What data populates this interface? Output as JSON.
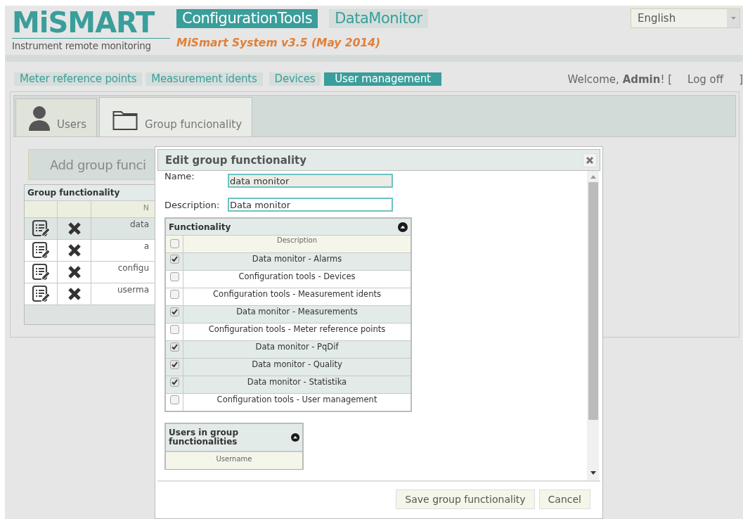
{
  "logo": {
    "brand": "MiSMART",
    "tagline": "Instrument remote monitoring"
  },
  "apps": [
    {
      "label": "ConfigurationTools",
      "selected": true
    },
    {
      "label": "DataMonitor",
      "selected": false
    }
  ],
  "version": "MiSmart System v3.5 (May 2014)",
  "language": {
    "value": "English"
  },
  "menu": [
    {
      "label": "Meter reference points",
      "selected": false
    },
    {
      "label": "Measurement idents",
      "selected": false
    },
    {
      "label": "Devices",
      "selected": false
    },
    {
      "label": "User management",
      "selected": true
    }
  ],
  "user_bar": {
    "welcome": "Welcome, **Admin**! [",
    "logoff": "Log off",
    "bracket": "]"
  },
  "page_tabs": [
    {
      "label": "Users",
      "kind": "user",
      "selected": false
    },
    {
      "label": "Group funcionality",
      "kind": "folder",
      "selected": true
    }
  ],
  "add_button": "Add group funci",
  "group_table": {
    "title": "Group functionality",
    "column_3": "N",
    "rows": [
      {
        "name": "data",
        "selected": true
      },
      {
        "name": "a",
        "selected": false
      },
      {
        "name": "configu",
        "selected": false
      },
      {
        "name": "userma",
        "selected": false
      }
    ]
  },
  "dialog": {
    "title": "Edit group functionality",
    "fields": [
      {
        "label": "Name:",
        "value": "data monitor",
        "disabled": true
      },
      {
        "label": "Description:",
        "value": "Data monitor",
        "disabled": false
      }
    ],
    "functionality": {
      "title": "Functionality",
      "header": "Description",
      "all_checked": false,
      "rows": [
        {
          "label": "Data monitor - Alarms",
          "checked": true
        },
        {
          "label": "Configuration tools - Devices",
          "checked": false
        },
        {
          "label": "Configuration tools - Measurement idents",
          "checked": false
        },
        {
          "label": "Data monitor - Measurements",
          "checked": true
        },
        {
          "label": "Configuration tools - Meter reference points",
          "checked": false
        },
        {
          "label": "Data monitor - PqDif",
          "checked": true
        },
        {
          "label": "Data monitor - Quality",
          "checked": true
        },
        {
          "label": "Data monitor - Statistika",
          "checked": true
        },
        {
          "label": "Configuration tools - User management",
          "checked": false
        }
      ]
    },
    "users": {
      "title": "Users in group functionalities",
      "header": "Username"
    },
    "buttons": [
      "Save group functionality",
      "Cancel"
    ]
  }
}
